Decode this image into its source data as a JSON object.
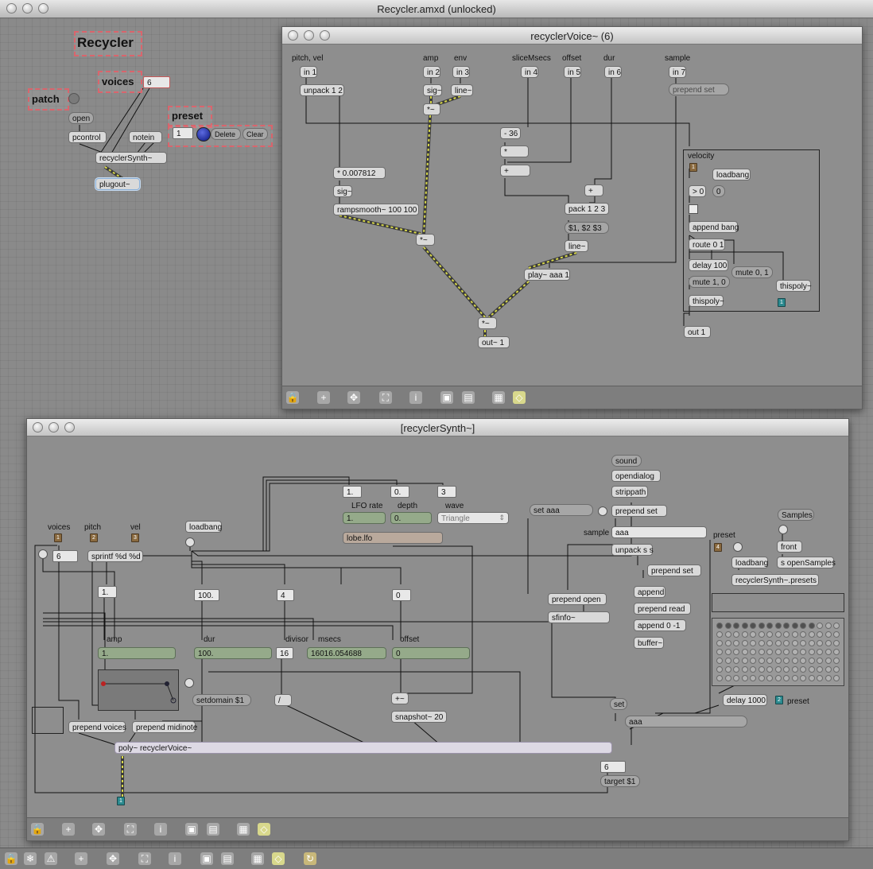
{
  "app": {
    "title": "Recycler.amxd (unlocked)"
  },
  "main": {
    "title": "Recycler",
    "voices_label": "voices",
    "voices_value": "6",
    "patch_label": "patch",
    "open_btn": "open",
    "pcontrol": "pcontrol",
    "notein": "notein",
    "synth": "recyclerSynth~",
    "plugout": "plugout~",
    "preset_label": "preset",
    "preset_num": "1",
    "delete_btn": "Delete",
    "clear_btn": "Clear"
  },
  "voice_win": {
    "title": "recyclerVoice~ (6)",
    "labels": {
      "pitchvel": "pitch, vel",
      "amp": "amp",
      "env": "env",
      "slice": "sliceMsecs",
      "offset": "offset",
      "dur": "dur",
      "sample": "sample",
      "velocity": "velocity"
    },
    "in1": "in 1",
    "in2": "in 2",
    "in3": "in 3",
    "in4": "in 4",
    "in5": "in 5",
    "in6": "in 6",
    "in7": "in 7",
    "unpack": "unpack 1 2",
    "sig1": "sig~",
    "line1": "line~",
    "mul1": "*~",
    "prependset": "prepend set",
    "minus36": "- 36",
    "times": "*",
    "plus": "+",
    "plus2": "+",
    "mul007": "* 0.007812",
    "sig2": "sig~",
    "ramp": "rampsmooth~ 100 100",
    "pack": "pack 1 2 3",
    "fmt": "$1, $2 $3",
    "line2": "line~",
    "mul2": "*~",
    "play": "play~ aaa 1",
    "mul3": "*~",
    "out": "out~ 1",
    "loadbang": "loadbang",
    "gt0": "> 0",
    "zero": "0",
    "appendbang": "append bang",
    "route": "route 0 1",
    "delay": "delay 100",
    "mute01": "mute 0, 1",
    "mute10": "mute 1, 0",
    "thispoly1": "thispoly~",
    "thispoly2": "thispoly~",
    "out1": "out 1",
    "in_num": "1",
    "out_num": "1"
  },
  "synth_win": {
    "title": "[recyclerSynth~]",
    "labels": {
      "voices": "voices",
      "pitch": "pitch",
      "vel": "vel",
      "lfo_rate": "LFO rate",
      "depth": "depth",
      "wave": "wave",
      "sample": "sample",
      "amp": "amp",
      "dur": "dur",
      "divisor": "divisor",
      "msecs": "msecs",
      "offset": "offset",
      "preset": "preset"
    },
    "in_voices": "1",
    "in_pitch": "2",
    "in_vel": "3",
    "in_preset": "4",
    "voices_num": "6",
    "sprintf": "sprintf %d %d",
    "loadbang": "loadbang",
    "n1": "1.",
    "n0": "0.",
    "n3": "3",
    "lfo_rate_val": "1.",
    "depth_val": "0.",
    "wave_val": "Triangle",
    "lobe": "lobe.lfo",
    "sound": "sound",
    "opendialog": "opendialog",
    "strippath": "strippath",
    "setaaa": "set aaa",
    "prependset": "prepend set",
    "aaa": "aaa",
    "unpackss": "unpack s s",
    "prependset2": "prepend set",
    "append": "append",
    "prependread": "prepend read",
    "append01": "append 0 -1",
    "buffer": "buffer~",
    "prependopen": "prepend open",
    "sfinfo": "sfinfo~",
    "samples": "Samples",
    "front": "front",
    "sopen": "s openSamples",
    "loadbang2": "loadbang",
    "presets": "recyclerSynth~.presets",
    "n1b": "1.",
    "n100": "100.",
    "n4": "4",
    "n0b": "0",
    "amp_val": "1.",
    "dur_val": "100.",
    "divisor_val": "16",
    "msecs_val": "16016.054688",
    "offset_val": "0",
    "setdomain": "setdomain $1",
    "div": "/",
    "plusmul": "+~",
    "snapshot": "snapshot~ 20",
    "set": "set",
    "aaa2": "aaa",
    "delay1000": "delay 1000",
    "preset_out": "preset",
    "preset_out_num": "2",
    "prependvoices": "prepend voices",
    "prependmidi": "prepend midinote",
    "poly": "poly~ recyclerVoice~",
    "num6": "6",
    "target": "target $1",
    "out_num": "1"
  }
}
